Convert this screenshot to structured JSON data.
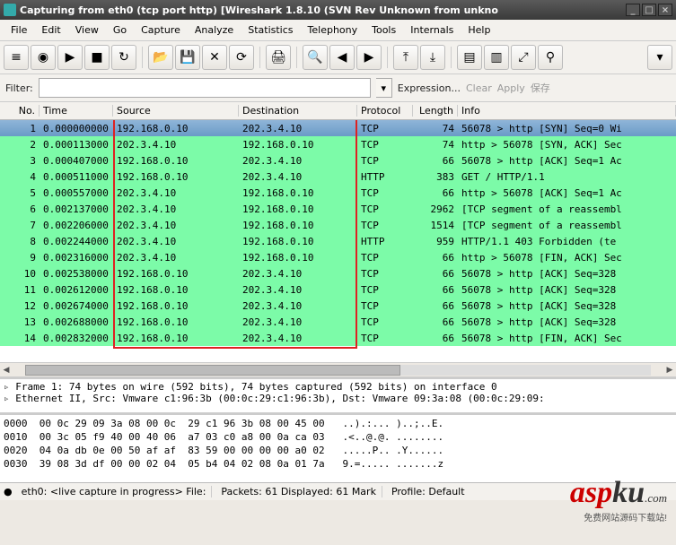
{
  "window": {
    "title": "Capturing from eth0  (tcp port http)   [Wireshark  1.8.10  (SVN Rev Unknown from unkno",
    "min": "_",
    "max": "□",
    "close": "×"
  },
  "menu": [
    "File",
    "Edit",
    "View",
    "Go",
    "Capture",
    "Analyze",
    "Statistics",
    "Telephony",
    "Tools",
    "Internals",
    "Help"
  ],
  "toolbar_icons": [
    "device-list",
    "device",
    "capture-start",
    "capture-stop",
    "capture-restart",
    "open",
    "save",
    "close",
    "refresh",
    "print",
    "find",
    "prev",
    "next",
    "goto-first",
    "goto-last",
    "colorize",
    "auto-scroll",
    "resize",
    "zoom"
  ],
  "filter": {
    "label": "Filter:",
    "value": "",
    "expr": "Expression...",
    "clear": "Clear",
    "apply": "Apply",
    "save": "保存"
  },
  "columns": {
    "no": "No.",
    "time": "Time",
    "src": "Source",
    "dst": "Destination",
    "proto": "Protocol",
    "len": "Length",
    "info": "Info"
  },
  "packets": [
    {
      "no": "1",
      "time": "0.000000000",
      "src": "192.168.0.10",
      "dst": "202.3.4.10",
      "proto": "TCP",
      "len": "74",
      "info": "56078 > http [SYN] Seq=0 Wi",
      "sel": true
    },
    {
      "no": "2",
      "time": "0.000113000",
      "src": "202.3.4.10",
      "dst": "192.168.0.10",
      "proto": "TCP",
      "len": "74",
      "info": "http > 56078 [SYN, ACK] Sec"
    },
    {
      "no": "3",
      "time": "0.000407000",
      "src": "192.168.0.10",
      "dst": "202.3.4.10",
      "proto": "TCP",
      "len": "66",
      "info": "56078 > http [ACK] Seq=1 Ac"
    },
    {
      "no": "4",
      "time": "0.000511000",
      "src": "192.168.0.10",
      "dst": "202.3.4.10",
      "proto": "HTTP",
      "len": "383",
      "info": "GET / HTTP/1.1"
    },
    {
      "no": "5",
      "time": "0.000557000",
      "src": "202.3.4.10",
      "dst": "192.168.0.10",
      "proto": "TCP",
      "len": "66",
      "info": "http > 56078 [ACK] Seq=1 Ac"
    },
    {
      "no": "6",
      "time": "0.002137000",
      "src": "202.3.4.10",
      "dst": "192.168.0.10",
      "proto": "TCP",
      "len": "2962",
      "info": "[TCP segment of a reassembl"
    },
    {
      "no": "7",
      "time": "0.002206000",
      "src": "202.3.4.10",
      "dst": "192.168.0.10",
      "proto": "TCP",
      "len": "1514",
      "info": "[TCP segment of a reassembl"
    },
    {
      "no": "8",
      "time": "0.002244000",
      "src": "202.3.4.10",
      "dst": "192.168.0.10",
      "proto": "HTTP",
      "len": "959",
      "info": "HTTP/1.1 403 Forbidden  (te"
    },
    {
      "no": "9",
      "time": "0.002316000",
      "src": "202.3.4.10",
      "dst": "192.168.0.10",
      "proto": "TCP",
      "len": "66",
      "info": "http > 56078 [FIN, ACK] Sec"
    },
    {
      "no": "10",
      "time": "0.002538000",
      "src": "192.168.0.10",
      "dst": "202.3.4.10",
      "proto": "TCP",
      "len": "66",
      "info": "56078 > http [ACK] Seq=328 "
    },
    {
      "no": "11",
      "time": "0.002612000",
      "src": "192.168.0.10",
      "dst": "202.3.4.10",
      "proto": "TCP",
      "len": "66",
      "info": "56078 > http [ACK] Seq=328 "
    },
    {
      "no": "12",
      "time": "0.002674000",
      "src": "192.168.0.10",
      "dst": "202.3.4.10",
      "proto": "TCP",
      "len": "66",
      "info": "56078 > http [ACK] Seq=328 "
    },
    {
      "no": "13",
      "time": "0.002688000",
      "src": "192.168.0.10",
      "dst": "202.3.4.10",
      "proto": "TCP",
      "len": "66",
      "info": "56078 > http [ACK] Seq=328 "
    },
    {
      "no": "14",
      "time": "0.002832000",
      "src": "192.168.0.10",
      "dst": "202.3.4.10",
      "proto": "TCP",
      "len": "66",
      "info": "56078 > http [FIN, ACK] Sec"
    }
  ],
  "detail": {
    "l1": "Frame 1: 74 bytes on wire (592 bits), 74 bytes captured (592 bits) on interface 0",
    "l2": "Ethernet II, Src: Vmware c1:96:3b (00:0c:29:c1:96:3b), Dst: Vmware 09:3a:08 (00:0c:29:09:"
  },
  "hex": {
    "l0": "0000  00 0c 29 09 3a 08 00 0c  29 c1 96 3b 08 00 45 00   ..).:... )..;..E.",
    "l1": "0010  00 3c 05 f9 40 00 40 06  a7 03 c0 a8 00 0a ca 03   .<..@.@. ........",
    "l2": "0020  04 0a db 0e 00 50 af af  83 59 00 00 00 00 a0 02   .....P.. .Y......",
    "l3": "0030  39 08 3d df 00 00 02 04  05 b4 04 02 08 0a 01 7a   9.=..... .......z"
  },
  "status": {
    "iface": "eth0: <live capture in progress> File:",
    "pkts": "Packets: 61 Displayed: 61 Mark",
    "profile": "Profile: Default"
  },
  "watermark": {
    "t1": "asp",
    "t2": "ku",
    "t3": ".com",
    "sub": "免费网站源码下载站!"
  }
}
